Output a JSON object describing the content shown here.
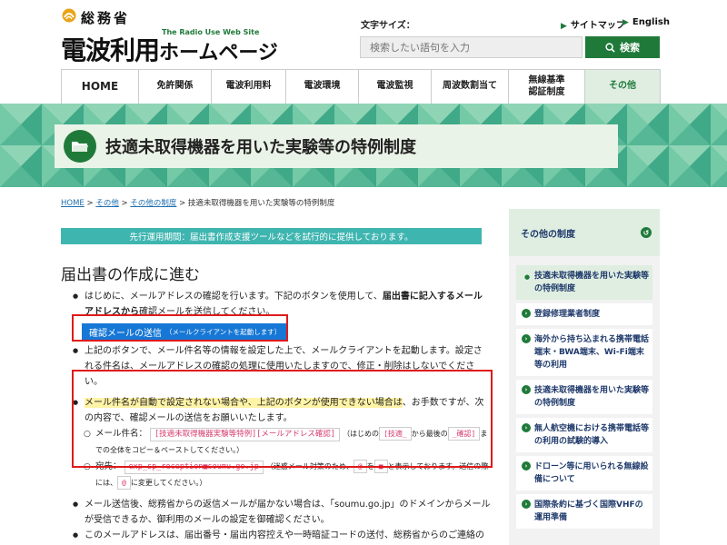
{
  "header": {
    "ministry": "総務省",
    "site_en": "The Radio Use Web Site",
    "site_title_main": "電波利用",
    "site_title_sub": "ホームページ",
    "font_size_label": "文字サイズ：",
    "sitemap": "サイトマップ",
    "english": "English",
    "search_placeholder": "検索したい語句を入力",
    "search_button": "検索"
  },
  "nav": {
    "items": [
      {
        "label": "HOME"
      },
      {
        "label": "免許関係"
      },
      {
        "label": "電波利用料"
      },
      {
        "label": "電波環境"
      },
      {
        "label": "電波監視"
      },
      {
        "label": "周波数割当て"
      },
      {
        "label1": "無線基準",
        "label2": "認証制度"
      },
      {
        "label": "その他"
      }
    ]
  },
  "banner": {
    "title": "技適未取得機器を用いた実験等の特例制度"
  },
  "breadcrumb": {
    "home": "HOME",
    "sep": " > ",
    "other": "その他",
    "other_system": "その他の制度",
    "current": "技適未取得機器を用いた実験等の特例制度"
  },
  "notice": "先行運用期間：届出書作成支援ツールなどを試行的に提供しております。",
  "section_title": "届出書の作成に進む",
  "content": {
    "p1_a": "はじめに、メールアドレスの確認を行います。下記のボタンを使用して、",
    "p1_b": "届出書に記入するメールアドレスから",
    "p1_c": "確認メールを送信してください。",
    "confirm_button": "確認メールの送信",
    "confirm_button_sub": "（メールクライアントを起動します）",
    "p2": "上記のボタンで、メール件名等の情報を設定した上で、メールクライアントを起動します。設定される件名は、メールアドレスの確認の処理に使用いたしますので、修正・削除はしないでください。",
    "p3_hl": "メール件名が自動で設定されない場合や、上記のボタンが使用できない場合は",
    "p3_rest": "、お手数ですが、次の内容で、確認メールの送信をお願いいたします。",
    "subject_label": "メール件名：",
    "subject_code": "[技適未取得機器実験等特例][メールアドレス確認]",
    "subject_note_a": "（はじめの",
    "subject_note_code1": "[技適_",
    "subject_note_b": "から最後の",
    "subject_note_code2": "_確認]",
    "subject_note_c": "までの全体をコピー＆ペーストしてください。）",
    "to_label": "宛先：",
    "to_code": "exp_sp_reception■soumu.go.jp",
    "to_note_a": "（迷惑メール対策のため、",
    "to_note_code1": "@",
    "to_note_b": "を",
    "to_note_code2": "■",
    "to_note_c": "と表示しております。送信の際には、",
    "to_note_code3": "@",
    "to_note_d": "に変更してください。）",
    "p4": "メール送信後、総務省からの返信メールが届かない場合は、「soumu.go.jp」のドメインからメールが受信できるか、御利用のメールの設定を御確認ください。",
    "p5": "このメールアドレスは、届出番号・届出内容控えや一時暗証コードの送付、総務省からのご連絡のために使用します。"
  },
  "sidebar": {
    "heading": "その他の制度",
    "items": [
      {
        "label": "技適未取得機器を用いた実験等の特例制度"
      },
      {
        "label": "登録修理業者制度"
      },
      {
        "label": "海外から持ち込まれる携帯電話端末・BWA端末、Wi-Fi端末等の利用"
      },
      {
        "label": "技適未取得機器を用いた実験等の特例制度"
      },
      {
        "label": "無人航空機における携帯電話等の利用の試験的導入"
      },
      {
        "label": "ドローン等に用いられる無線設備について"
      },
      {
        "label": "国際条約に基づく国際VHFの運用準備"
      }
    ]
  },
  "colors": {
    "brand": "#1f7a3a",
    "accent_red": "#e01a1a",
    "button_blue": "#1677d6",
    "notice_teal": "#3fb5b0"
  }
}
